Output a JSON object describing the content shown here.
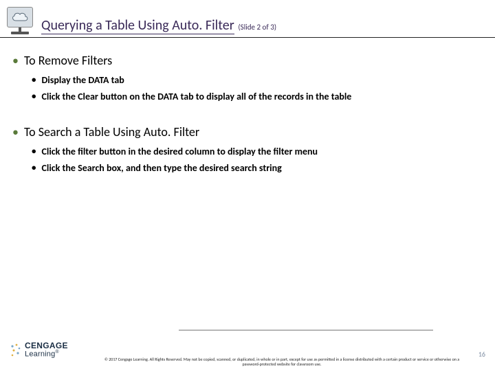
{
  "header": {
    "title": "Querying a Table Using Auto. Filter",
    "subtitle": "(Slide 2 of 3)",
    "icon_name": "cloud"
  },
  "sections": [
    {
      "heading": "To Remove Filters",
      "items": [
        "Display the DATA tab",
        "Click the Clear button on the DATA tab to display all of the records in the table"
      ]
    },
    {
      "heading": "To Search a Table Using Auto. Filter",
      "items": [
        "Click the filter button in the desired column to display the filter menu",
        "Click the Search box, and then type the desired search string"
      ]
    }
  ],
  "footer": {
    "logo_top": "CENGAGE",
    "logo_bottom": "Learning",
    "copyright": "© 2017 Cengage Learning. All Rights Reserved. May not be copied, scanned, or duplicated, in whole or in part, except for use as permitted in a license distributed with a certain product or service or otherwise on a password-protected website for classroom use.",
    "page_number": "16"
  }
}
